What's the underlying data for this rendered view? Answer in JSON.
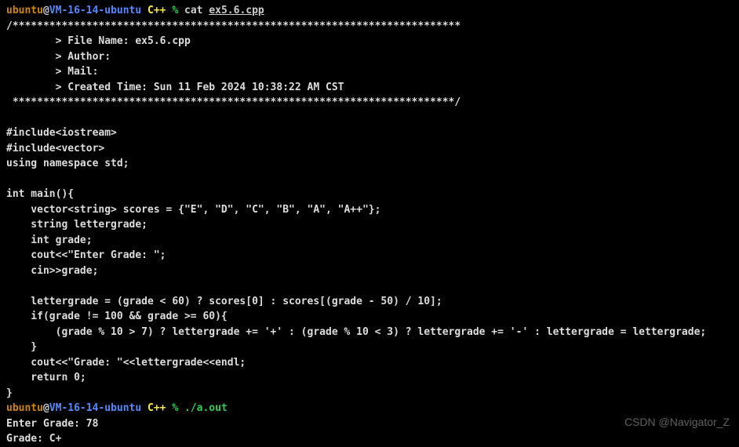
{
  "prompt1": {
    "user": "ubuntu",
    "at": "@",
    "host": "VM-16-14-ubuntu",
    "path": " C++ ",
    "sym": "% ",
    "cmd": "cat ",
    "file": "ex5.6.cpp"
  },
  "code": {
    "l1": "/*************************************************************************",
    "l2": "        > File Name: ex5.6.cpp",
    "l3": "        > Author:",
    "l4": "        > Mail:",
    "l5": "        > Created Time: Sun 11 Feb 2024 10:38:22 AM CST",
    "l6": " ************************************************************************/",
    "l7": "",
    "l8": "#include<iostream>",
    "l9": "#include<vector>",
    "l10": "using namespace std;",
    "l11": "",
    "l12": "int main(){",
    "l13": "    vector<string> scores = {\"E\", \"D\", \"C\", \"B\", \"A\", \"A++\"};",
    "l14": "    string lettergrade;",
    "l15": "    int grade;",
    "l16": "    cout<<\"Enter Grade: \";",
    "l17": "    cin>>grade;",
    "l18": "",
    "l19": "    lettergrade = (grade < 60) ? scores[0] : scores[(grade - 50) / 10];",
    "l20": "    if(grade != 100 && grade >= 60){",
    "l21": "        (grade % 10 > 7) ? lettergrade += '+' : (grade % 10 < 3) ? lettergrade += '-' : lettergrade = lettergrade;",
    "l22": "    }",
    "l23": "    cout<<\"Grade: \"<<lettergrade<<endl;",
    "l24": "    return 0;",
    "l25": "}"
  },
  "prompt2": {
    "user": "ubuntu",
    "at": "@",
    "host": "VM-16-14-ubuntu",
    "path": " C++ ",
    "sym": "% ",
    "exec": "./a.out"
  },
  "output": {
    "l1": "Enter Grade: 78",
    "l2": "Grade: C+"
  },
  "watermark": "CSDN @Navigator_Z"
}
